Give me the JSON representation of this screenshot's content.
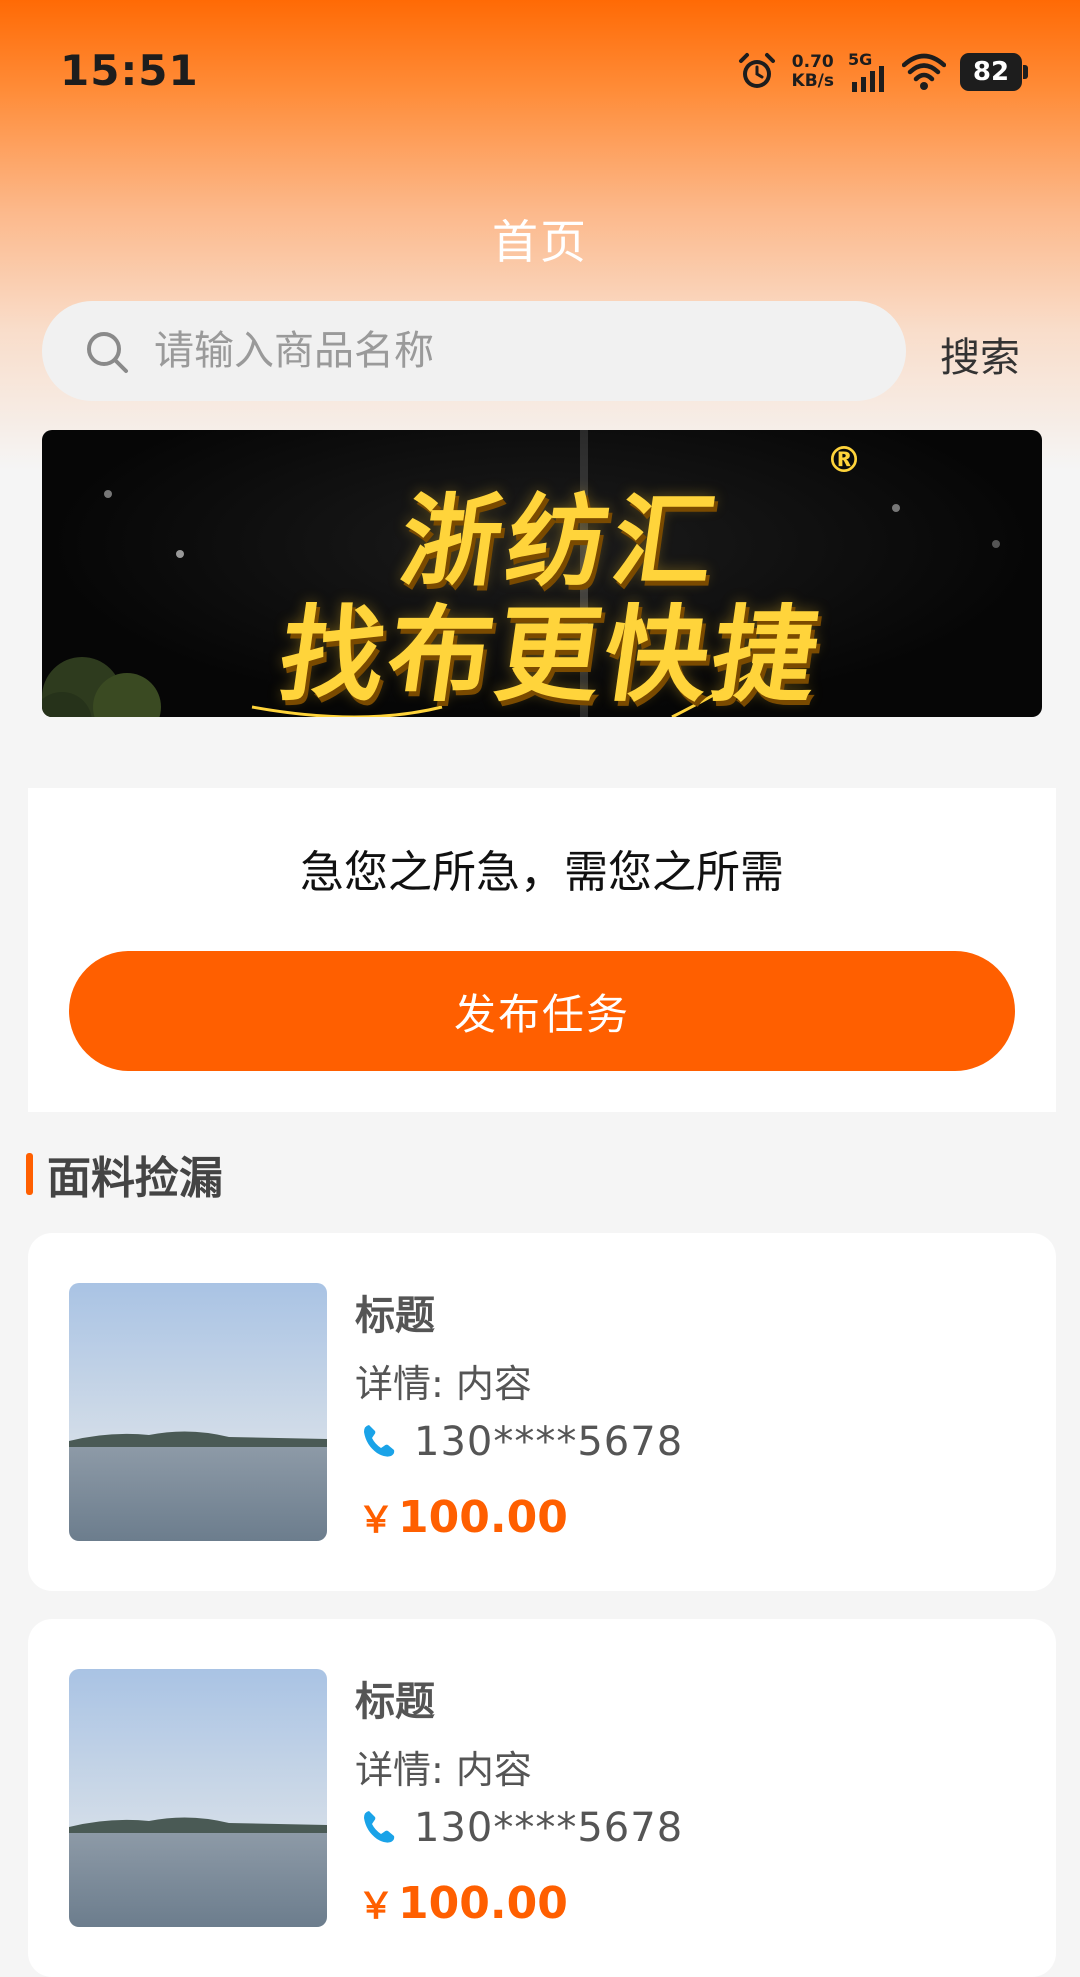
{
  "status_bar": {
    "time": "15:51",
    "net_speed_value": "0.70",
    "net_speed_unit": "KB/s",
    "network_type": "5G",
    "battery": "82"
  },
  "header": {
    "title": "首页"
  },
  "search": {
    "placeholder": "请输入商品名称",
    "button_label": "搜索"
  },
  "banner": {
    "line1": "浙纺汇",
    "line2": "找布更快捷",
    "mark": "®"
  },
  "task": {
    "slogan": "急您之所急，需您之所需",
    "publish_label": "发布任务"
  },
  "section": {
    "title": "面料捡漏"
  },
  "products": [
    {
      "title": "标题",
      "detail": "详情: 内容",
      "phone": "130****5678",
      "currency": "￥",
      "price": "100.00"
    },
    {
      "title": "标题",
      "detail": "详情: 内容",
      "phone": "130****5678",
      "currency": "￥",
      "price": "100.00"
    }
  ],
  "colors": {
    "accent": "#ff5f00",
    "phone_icon": "#1aa3e8",
    "banner_text": "#ffd43b"
  }
}
